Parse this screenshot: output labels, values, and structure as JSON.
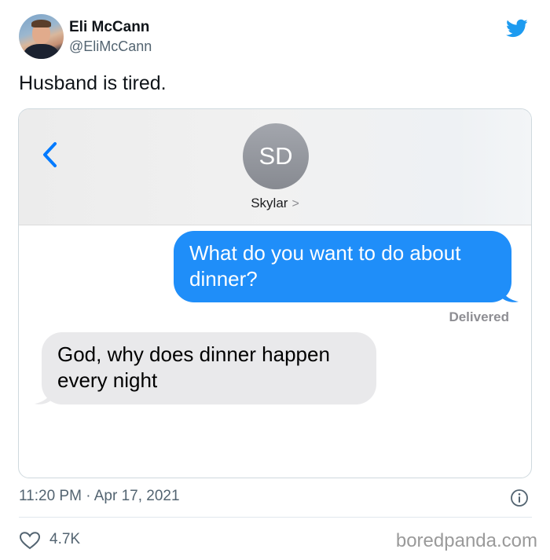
{
  "author": {
    "name": "Eli McCann",
    "handle": "@EliMcCann"
  },
  "tweet": {
    "text": "Husband is tired.",
    "timestamp": "11:20 PM · Apr 17, 2021",
    "likes": "4.7K"
  },
  "conversation": {
    "contact_initials": "SD",
    "contact_name": "Skylar",
    "contact_chevron": ">",
    "messages": [
      {
        "direction": "outgoing",
        "text": "What do you want to do about dinner?"
      },
      {
        "direction": "incoming",
        "text": "God, why does dinner happen every night"
      }
    ],
    "status": "Delivered"
  },
  "watermark": "boredpanda.com",
  "colors": {
    "twitter_blue": "#1d9bf0",
    "imessage_blue": "#1f8ef9",
    "incoming_bubble": "#e9e9eb",
    "ios_link_blue": "#007aff"
  },
  "icons": [
    "twitter-bird-icon",
    "back-chevron-icon",
    "info-icon",
    "heart-icon"
  ]
}
